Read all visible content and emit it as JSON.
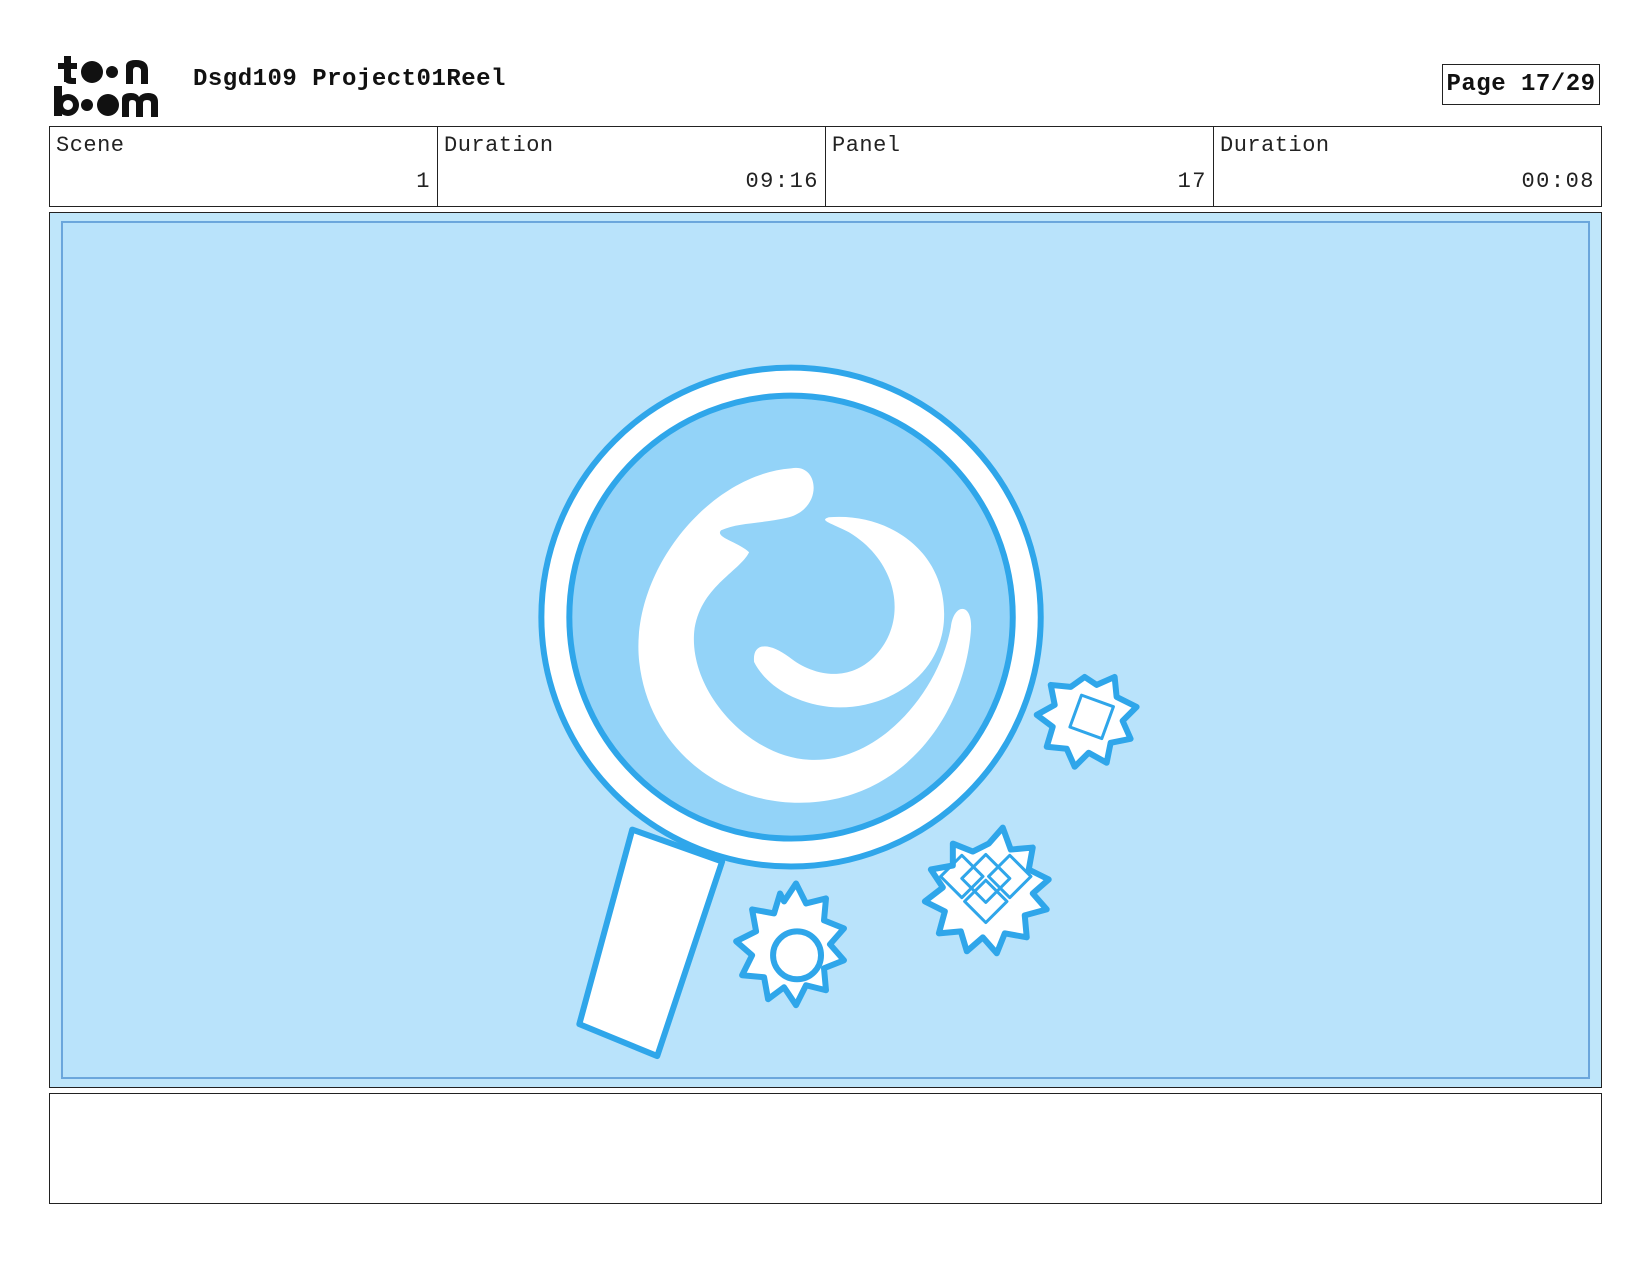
{
  "header": {
    "logo_name": "toon boom",
    "project_title": "Dsgd109 Project01Reel",
    "page_label": "Page 17/29"
  },
  "info": {
    "scene_label": "Scene",
    "scene_value": "1",
    "scene_duration_label": "Duration",
    "scene_duration_value": "09:16",
    "panel_label": "Panel",
    "panel_value": "17",
    "panel_duration_label": "Duration",
    "panel_duration_value": "00:08"
  },
  "panel": {
    "background_color": "#bce5fb",
    "inner_border_color": "#6aa6dc",
    "outline_color": "#2fa6ea",
    "lens_color": "#93d3f8",
    "icons": [
      "magnifier-icon",
      "swirl-icon",
      "gear-icon"
    ]
  },
  "notes": {
    "text": ""
  }
}
